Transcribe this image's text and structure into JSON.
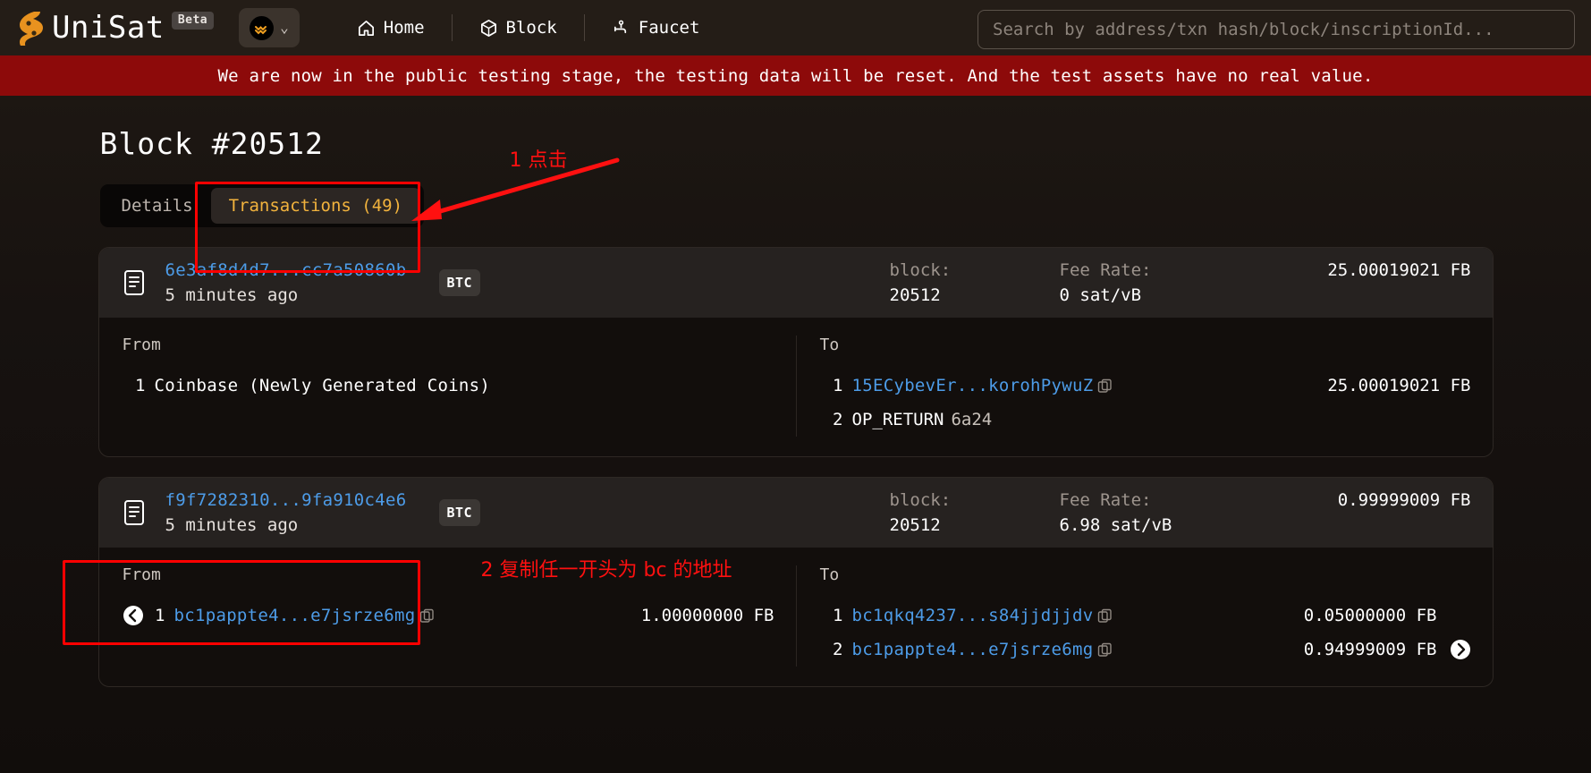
{
  "header": {
    "brand": "UniSat",
    "beta_label": "Beta",
    "nav": [
      {
        "label": "Home",
        "icon": "home-icon"
      },
      {
        "label": "Block",
        "icon": "cube-icon"
      },
      {
        "label": "Faucet",
        "icon": "faucet-icon"
      }
    ],
    "search_placeholder": "Search by address/txn hash/block/inscriptionId...",
    "search_value": ""
  },
  "banner": {
    "text": "We are now in the public testing stage, the testing data will be reset. And the test assets have no real value.",
    "color": "#8d0a0a"
  },
  "page": {
    "title": "Block #20512",
    "tabs": [
      {
        "label": "Details",
        "active": false
      },
      {
        "label": "Transactions (49)",
        "active": true
      }
    ],
    "accent_color": "#f2b33d",
    "link_color": "#4d9ce8"
  },
  "transactions": [
    {
      "hash": "6e3af8d4d7...cc7a50860b",
      "time": "5 minutes ago",
      "chain_chip": "BTC",
      "block_label": "block:",
      "block_value": "20512",
      "fee_label": "Fee Rate:",
      "fee_value": "0 sat/vB",
      "total_amount": "25.00019021 FB",
      "from_label": "From",
      "to_label": "To",
      "inputs": [
        {
          "index": "1",
          "text": "Coinbase (Newly Generated Coins)",
          "type": "plain",
          "amount": "",
          "copy": false,
          "back": false
        }
      ],
      "outputs": [
        {
          "index": "1",
          "text": "15ECybevEr...korohPywuZ",
          "type": "link",
          "amount": "25.00019021 FB",
          "copy": true,
          "fwd": false
        },
        {
          "index": "2",
          "text": "OP_RETURN",
          "hex": "6a24",
          "type": "op",
          "amount": "",
          "copy": false,
          "fwd": false
        }
      ]
    },
    {
      "hash": "f9f7282310...9fa910c4e6",
      "time": "5 minutes ago",
      "chain_chip": "BTC",
      "block_label": "block:",
      "block_value": "20512",
      "fee_label": "Fee Rate:",
      "fee_value": "6.98 sat/vB",
      "total_amount": "0.99999009 FB",
      "from_label": "From",
      "to_label": "To",
      "inputs": [
        {
          "index": "1",
          "text": "bc1pappte4...e7jsrze6mg",
          "type": "link",
          "amount": "1.00000000 FB",
          "copy": true,
          "back": true
        }
      ],
      "outputs": [
        {
          "index": "1",
          "text": "bc1qkq4237...s84jjdjjdv",
          "type": "link",
          "amount": "0.05000000 FB",
          "copy": true,
          "fwd": false
        },
        {
          "index": "2",
          "text": "bc1pappte4...e7jsrze6mg",
          "type": "link",
          "amount": "0.94999009 FB",
          "copy": true,
          "fwd": true
        }
      ]
    }
  ],
  "annotations": [
    {
      "id": "step-1",
      "text": "1 点击",
      "color": "#ff1010"
    },
    {
      "id": "step-2",
      "text": "2 复制任一开头为 bc 的地址",
      "color": "#ff1010"
    }
  ]
}
